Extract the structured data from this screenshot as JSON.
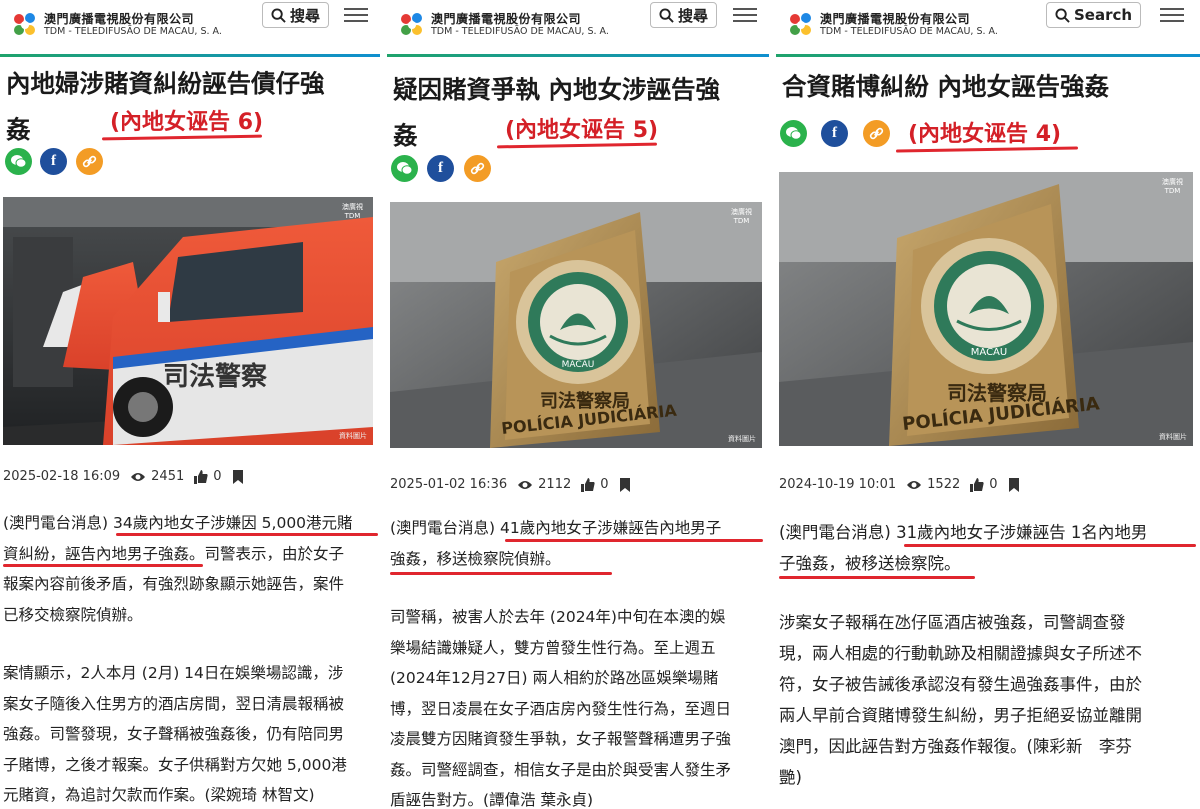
{
  "brand": {
    "name_cn": "澳門廣播電視股份有限公司",
    "name_en": "TDM - TELEDIFUSÃO DE MACAU, S. A.",
    "accent": "#1fa36b",
    "menu_icon": "hamburger-icon"
  },
  "annotation_color": "#d42027",
  "panels": [
    {
      "search_label": "搜尋",
      "title_lines": [
        "內地婦涉賭資糾紛誣告債仔強",
        "姦"
      ],
      "tag": "(內地女诬告 6)",
      "share_icons": [
        "wechat-icon",
        "facebook-icon",
        "link-icon"
      ],
      "photo": {
        "kind": "judiciary-police-car",
        "badge_top": "澳廣視",
        "badge_bottom": "TDM",
        "credit": "資料圖片",
        "car_text": "司法警察"
      },
      "meta": {
        "datetime": "2025-02-18 16:09",
        "views": "2451",
        "likes": "0"
      },
      "paragraphs": [
        [
          "(澳門電台消息) 34歲內地女子涉嫌因 5,000港元賭",
          "資糾紛，誣告內地男子強姦。司警表示，由於女子",
          "報案內容前後矛盾，有強烈跡象顯示她誣告，案件",
          "已移交檢察院偵辦。"
        ],
        [
          "案情顯示，2人本月 (2月) 14日在娛樂場認識，涉",
          "案女子隨後入住男方的酒店房間，翌日清晨報稱被",
          "強姦。司警發現，女子聲稱被強姦後，仍有陪同男",
          "子賭博，之後才報案。女子供稱對方欠她 5,000港",
          "元賭資，為追討欠款而作案。(梁婉琦 林智文)"
        ]
      ]
    },
    {
      "search_label": "搜尋",
      "title_lines": [
        "疑因賭資爭執 內地女涉誣告強",
        "姦"
      ],
      "tag": "(內地女诬告 5)",
      "share_icons": [
        "wechat-icon",
        "facebook-icon",
        "link-icon"
      ],
      "photo": {
        "kind": "policia-judiciaria-emblem",
        "badge_top": "澳廣視",
        "badge_bottom": "TDM",
        "credit": "資料圖片",
        "sign_cn": "司法警察局",
        "sign_pt": "POLÍCIA JUDICIÁRIA",
        "emblem_text": "MACAU"
      },
      "meta": {
        "datetime": "2025-01-02 16:36",
        "views": "2112",
        "likes": "0"
      },
      "paragraphs": [
        [
          "(澳門電台消息)  41歲內地女子涉嫌誣告內地男子",
          "強姦，移送檢察院偵辦。"
        ],
        [
          "司警稱，被害人於去年 (2024年)中旬在本澳的娛",
          "樂場結識嫌疑人，雙方曾發生性行為。至上週五",
          "(2024年12月27日) 兩人相約於路氹區娛樂場賭",
          "博，翌日凌晨在女子酒店房內發生性行為，至週日",
          "凌晨雙方因賭資發生爭執，女子報警聲稱遭男子強",
          "姦。司警經調查，相信女子是由於與受害人發生矛",
          "盾誣告對方。(譚偉浩 葉永貞)"
        ]
      ]
    },
    {
      "search_label": "Search",
      "title_lines": [
        "合資賭博糾紛 內地女誣告強姦"
      ],
      "tag": "(內地女诬告 4)",
      "share_icons": [
        "wechat-icon",
        "facebook-icon",
        "link-icon"
      ],
      "photo": {
        "kind": "policia-judiciaria-emblem",
        "badge_top": "澳廣視",
        "badge_bottom": "TDM",
        "credit": "資料圖片",
        "sign_cn": "司法警察局",
        "sign_pt": "POLÍCIA JUDICIÁRIA",
        "emblem_text": "MACAU"
      },
      "meta": {
        "datetime": "2024-10-19 10:01",
        "views": "1522",
        "likes": "0"
      },
      "paragraphs": [
        [
          "(澳門電台消息) 31歲內地女子涉嫌誣告 1名內地男",
          "子強姦，被移送檢察院。"
        ],
        [
          "涉案女子報稱在氹仔區酒店被強姦，司警調查發",
          "現，兩人相處的行動軌跡及相關證據與女子所述不",
          "符，女子被告誡後承認沒有發生過強姦事件，由於",
          "兩人早前合資賭博發生糾紛，男子拒絕妥協並離開",
          "澳門，因此誣告對方強姦作報復。(陳彩新　李芬",
          "艷)"
        ]
      ]
    }
  ]
}
